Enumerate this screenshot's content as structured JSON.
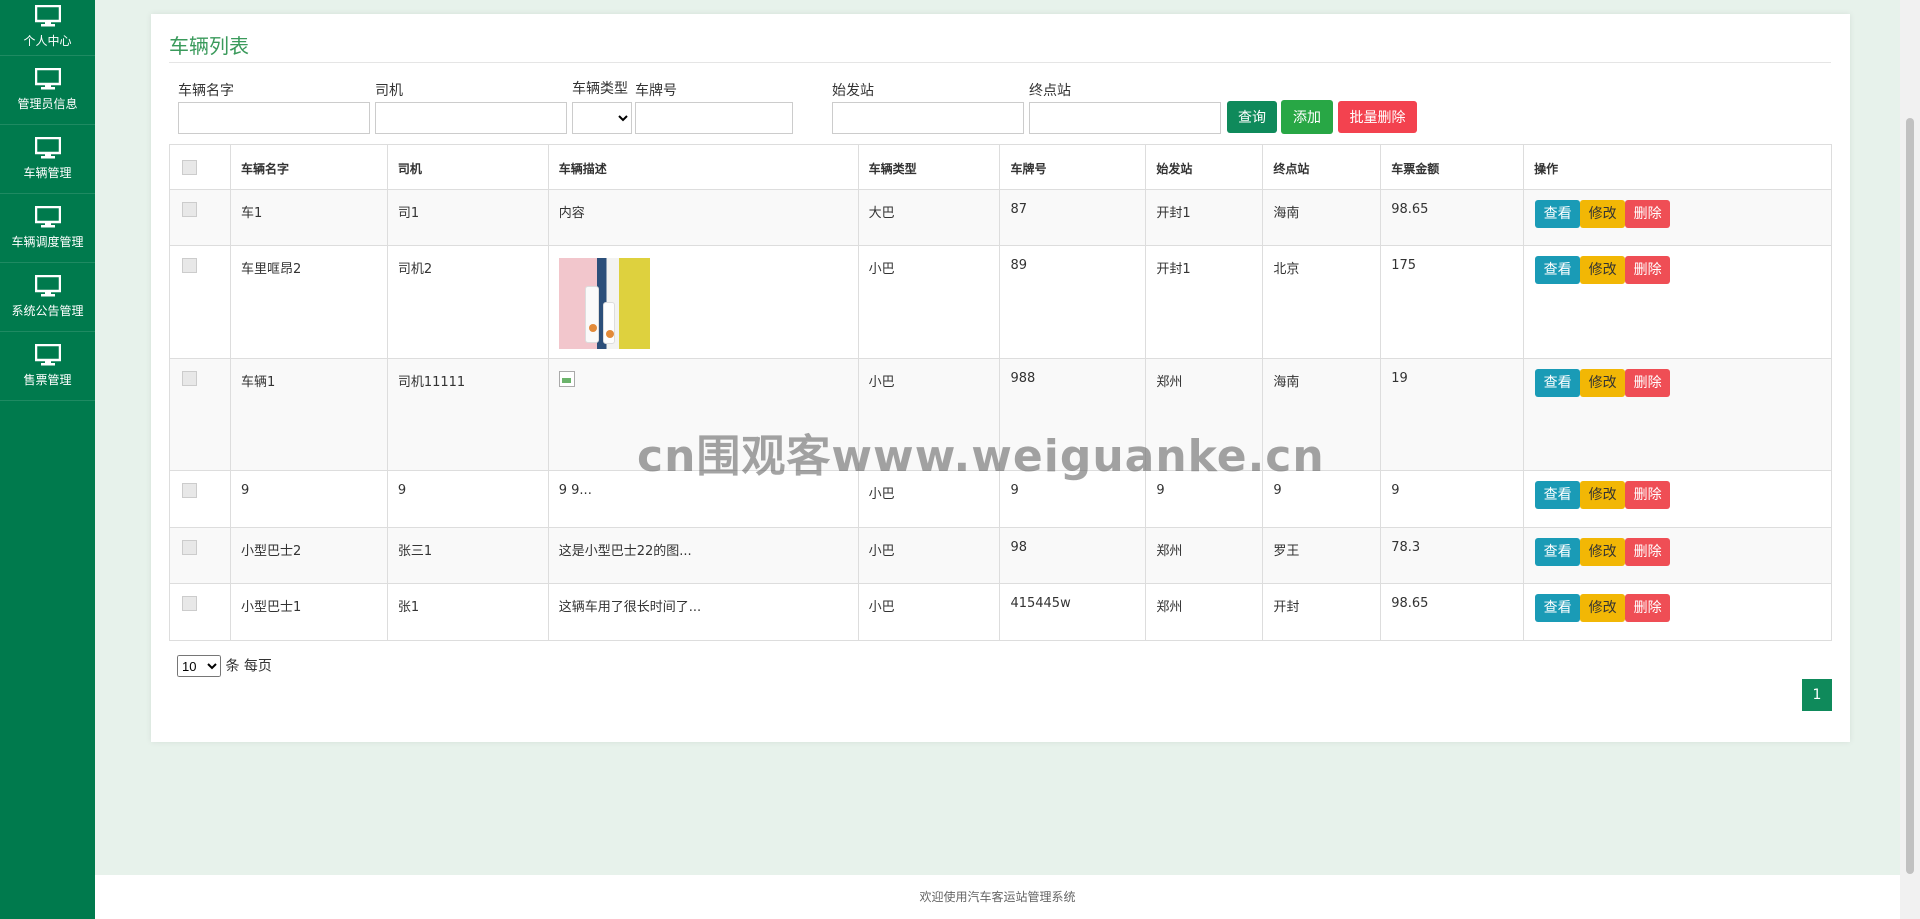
{
  "sidebar": {
    "items": [
      {
        "label": "个人中心"
      },
      {
        "label": "管理员信息"
      },
      {
        "label": "车辆管理"
      },
      {
        "label": "车辆调度管理"
      },
      {
        "label": "系统公告管理"
      },
      {
        "label": "售票管理"
      }
    ]
  },
  "card": {
    "title": "车辆列表"
  },
  "filters": {
    "name_label": "车辆名字",
    "driver_label": "司机",
    "type_label": "车辆类型",
    "plate_label": "车牌号",
    "start_label": "始发站",
    "end_label": "终点站",
    "type_value": ""
  },
  "buttons": {
    "query": "查询",
    "add": "添加",
    "batch_delete": "批量删除"
  },
  "table": {
    "headers": [
      "车辆名字",
      "司机",
      "车辆描述",
      "车辆类型",
      "车牌号",
      "始发站",
      "终点站",
      "车票金额",
      "操作"
    ],
    "action_labels": {
      "view": "查看",
      "edit": "修改",
      "delete": "删除"
    },
    "rows": [
      {
        "name": "车1",
        "driver": "司1",
        "desc": "内容",
        "type": "大巴",
        "plate": "87",
        "start": "开封1",
        "end": "海南",
        "price": "98.65"
      },
      {
        "name": "车里哐昂2",
        "driver": "司机2",
        "desc": "",
        "type": "小巴",
        "plate": "89",
        "start": "开封1",
        "end": "北京",
        "price": "175"
      },
      {
        "name": "车辆1",
        "driver": "司机11111",
        "desc": "",
        "type": "小巴",
        "plate": "988",
        "start": "郑州",
        "end": "海南",
        "price": "19"
      },
      {
        "name": "9",
        "driver": "9",
        "desc": "9 9...",
        "type": "小巴",
        "plate": "9",
        "start": "9",
        "end": "9",
        "price": "9"
      },
      {
        "name": "小型巴士2",
        "driver": "张三1",
        "desc": "这是小型巴士22的图...",
        "type": "小巴",
        "plate": "98",
        "start": "郑州",
        "end": "罗王",
        "price": "78.3"
      },
      {
        "name": "小型巴士1",
        "driver": "张1",
        "desc": "这辆车用了很长时间了...",
        "type": "小巴",
        "plate": "415445w",
        "start": "郑州",
        "end": "开封",
        "price": "98.65"
      }
    ]
  },
  "pagination": {
    "page_size": "10",
    "page_size_suffix": "条 每页",
    "current_page": "1"
  },
  "watermark": "cn围观客www.weiguanke.cn",
  "footer": "欢迎使用汽车客运站管理系统",
  "colors": {
    "sidebar": "#007a4d",
    "title": "#3a9a5b",
    "query": "#0f8a5b",
    "add": "#28a745",
    "batch_delete": "#f3424f",
    "view": "#1a9bb6",
    "edit": "#f2b705",
    "delete": "#ef4e55"
  }
}
